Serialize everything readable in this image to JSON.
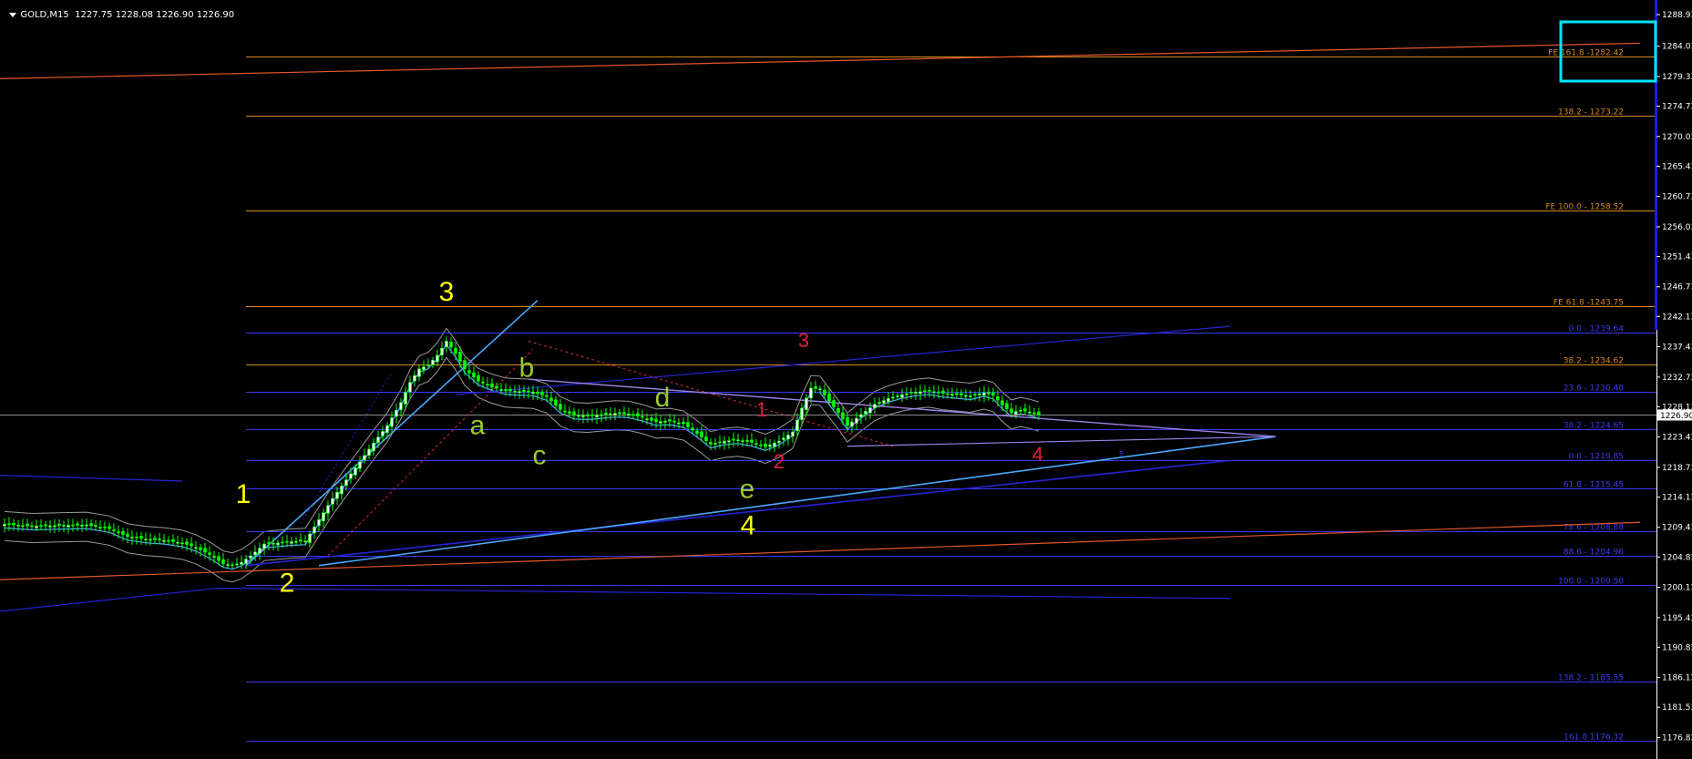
{
  "header": {
    "symbol": "GOLD,M15",
    "ohlc": "1227.75 1228.08 1226.90 1226.90"
  },
  "colors": {
    "background": "#000000",
    "axis": "#ffffff",
    "candle_bull": "#ffffff",
    "candle_bear": "#00ff00",
    "fe_level": "#d4881c",
    "fib_level": "#3a3af0",
    "channel": "#2424d8",
    "trend_orange": "#e4562a",
    "trend_lightblue": "#4aa8ff",
    "trend_violet": "#9b82e8",
    "bands": "#9a9a9a",
    "wave_primary": "#ffff00",
    "wave_secondary": "#9ac82e",
    "wave_minor": "#e0203c",
    "current_price_bg": "#ffffff",
    "highlight_box": "#00e5ff"
  },
  "chart_data": {
    "type": "candlestick",
    "symbol": "GOLD",
    "timeframe": "M15",
    "ylim": [
      1173.5,
      1291.2
    ],
    "y_ticks": [
      "1288.93",
      "1284.03",
      "1279.33",
      "1274.73",
      "1270.03",
      "1265.43",
      "1260.73",
      "1256.03",
      "1251.43",
      "1246.73",
      "1242.13",
      "1237.43",
      "1232.73",
      "1228.13",
      "1223.43",
      "1218.73",
      "1214.13",
      "1209.43",
      "1204.83",
      "1200.13",
      "1195.43",
      "1190.83",
      "1186.13",
      "1181.53",
      "1176.83"
    ],
    "current_price": "1226.90",
    "levels": [
      {
        "label": "FE 161.8 -1282.42",
        "value": 1282.42,
        "group": "fe"
      },
      {
        "label": "138.2 - 1273.22",
        "value": 1273.22,
        "group": "fe"
      },
      {
        "label": "FE 100.0 - 1258.52",
        "value": 1258.52,
        "group": "fe"
      },
      {
        "label": "FE 61.8 -1243.75",
        "value": 1243.75,
        "group": "fe"
      },
      {
        "label": "38.2 - 1234.62",
        "value": 1234.62,
        "group": "fe"
      },
      {
        "label": "0.0 - 1239.64",
        "value": 1239.64,
        "group": "fib"
      },
      {
        "label": "23.6 - 1230.40",
        "value": 1230.4,
        "group": "fib"
      },
      {
        "label": "38.2 - 1224.65",
        "value": 1224.65,
        "group": "fib"
      },
      {
        "label": "0.0 - 1219.85",
        "value": 1219.85,
        "group": "fib"
      },
      {
        "label": "61.8 - 1215.45",
        "value": 1215.45,
        "group": "fib"
      },
      {
        "label": "78.6 - 1208.88",
        "value": 1208.88,
        "group": "fib"
      },
      {
        "label": "88.6 - 1204.96",
        "value": 1204.96,
        "group": "fib"
      },
      {
        "label": "100.0 - 1200.50",
        "value": 1200.5,
        "group": "fib"
      },
      {
        "label": "138.2 - 1185.55",
        "value": 1185.55,
        "group": "fib"
      },
      {
        "label": "161.8 1176.32",
        "value": 1176.32,
        "group": "fib"
      }
    ],
    "close_path": [
      [
        5,
        1209.9
      ],
      [
        35,
        1209.6
      ],
      [
        65,
        1209.7
      ],
      [
        95,
        1209.8
      ],
      [
        120,
        1209.2
      ],
      [
        140,
        1208.0
      ],
      [
        160,
        1207.6
      ],
      [
        180,
        1207.4
      ],
      [
        200,
        1207.0
      ],
      [
        215,
        1206.3
      ],
      [
        230,
        1205.2
      ],
      [
        245,
        1203.8
      ],
      [
        255,
        1203.5
      ],
      [
        265,
        1204.0
      ],
      [
        275,
        1205.0
      ],
      [
        290,
        1206.8
      ],
      [
        305,
        1207.0
      ],
      [
        320,
        1207.2
      ],
      [
        335,
        1207.3
      ],
      [
        350,
        1210.6
      ],
      [
        365,
        1213.9
      ],
      [
        380,
        1216.8
      ],
      [
        395,
        1219.6
      ],
      [
        410,
        1222.5
      ],
      [
        425,
        1225.2
      ],
      [
        440,
        1228.8
      ],
      [
        450,
        1231.9
      ],
      [
        460,
        1234.0
      ],
      [
        470,
        1234.6
      ],
      [
        480,
        1236.1
      ],
      [
        490,
        1238.3
      ],
      [
        500,
        1236.4
      ],
      [
        510,
        1234.0
      ],
      [
        525,
        1232.1
      ],
      [
        540,
        1231.2
      ],
      [
        555,
        1230.6
      ],
      [
        570,
        1230.5
      ],
      [
        585,
        1230.4
      ],
      [
        600,
        1229.7
      ],
      [
        615,
        1227.7
      ],
      [
        630,
        1226.8
      ],
      [
        645,
        1226.7
      ],
      [
        660,
        1226.9
      ],
      [
        675,
        1227.1
      ],
      [
        690,
        1227.0
      ],
      [
        705,
        1226.5
      ],
      [
        720,
        1225.8
      ],
      [
        735,
        1225.9
      ],
      [
        750,
        1225.5
      ],
      [
        765,
        1224.0
      ],
      [
        780,
        1222.3
      ],
      [
        795,
        1222.8
      ],
      [
        810,
        1223.0
      ],
      [
        825,
        1222.6
      ],
      [
        840,
        1221.9
      ],
      [
        855,
        1222.8
      ],
      [
        870,
        1224.2
      ],
      [
        880,
        1227.9
      ],
      [
        890,
        1231.0
      ],
      [
        900,
        1230.9
      ],
      [
        910,
        1229.0
      ],
      [
        920,
        1227.2
      ],
      [
        930,
        1225.2
      ],
      [
        945,
        1226.9
      ],
      [
        960,
        1228.5
      ],
      [
        975,
        1229.4
      ],
      [
        990,
        1230.0
      ],
      [
        1005,
        1230.4
      ],
      [
        1020,
        1230.6
      ],
      [
        1035,
        1230.2
      ],
      [
        1050,
        1230.0
      ],
      [
        1065,
        1229.8
      ],
      [
        1080,
        1230.3
      ],
      [
        1090,
        1229.9
      ],
      [
        1100,
        1228.4
      ],
      [
        1110,
        1227.2
      ],
      [
        1120,
        1227.6
      ],
      [
        1130,
        1227.3
      ],
      [
        1140,
        1226.9
      ]
    ],
    "wave_labels": [
      {
        "text": "3",
        "x": 490,
        "price": 1244.6,
        "tier": "primary"
      },
      {
        "text": "1",
        "x": 267,
        "price": 1213.2,
        "tier": "primary"
      },
      {
        "text": "2",
        "x": 315,
        "price": 1199.4,
        "tier": "primary"
      },
      {
        "text": "4",
        "x": 821,
        "price": 1208.3,
        "tier": "primary"
      },
      {
        "text": "b",
        "x": 578,
        "price": 1232.8,
        "tier": "secondary"
      },
      {
        "text": "a",
        "x": 524,
        "price": 1223.9,
        "tier": "secondary"
      },
      {
        "text": "c",
        "x": 592,
        "price": 1219.2,
        "tier": "secondary"
      },
      {
        "text": "d",
        "x": 727,
        "price": 1228.2,
        "tier": "secondary"
      },
      {
        "text": "e",
        "x": 820,
        "price": 1214.0,
        "tier": "secondary"
      },
      {
        "text": "3",
        "x": 882,
        "price": 1237.4,
        "tier": "minor"
      },
      {
        "text": "1",
        "x": 836,
        "price": 1226.6,
        "tier": "minor"
      },
      {
        "text": "2",
        "x": 855,
        "price": 1218.6,
        "tier": "minor"
      },
      {
        "text": "4",
        "x": 1139,
        "price": 1219.7,
        "tier": "minor"
      }
    ],
    "small_marker": {
      "text": "5",
      "x": 1488,
      "price": 1220.4
    }
  }
}
